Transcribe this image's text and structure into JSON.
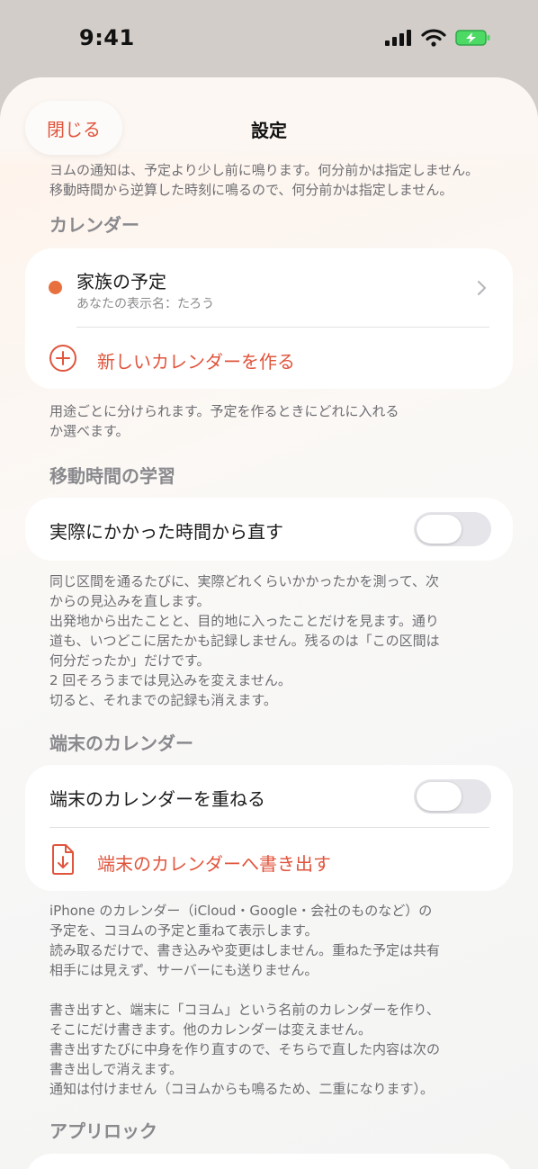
{
  "status": {
    "time": "9:41"
  },
  "nav": {
    "close_label": "閉じる",
    "title": "設定"
  },
  "top_note": {
    "partial_line": "ヨムの通知は、予定より少し前に鳴ります。何分前かは指定しません。",
    "line": "移動時間から逆算した時刻に鳴るので、何分前かは指定しません。"
  },
  "calendar": {
    "header": "カレンダー",
    "item_title": "家族の予定",
    "item_subtitle": "あなたの表示名：たろう",
    "new_label": "新しいカレンダーを作る",
    "dot_color": "#e8703f",
    "note": [
      "用途ごとに分けられます。予定を作るときにどれに入れる",
      "か選べます。"
    ]
  },
  "travel": {
    "header": "移動時間の学習",
    "toggle_label": "実際にかかった時間から直す",
    "toggle_on": false,
    "note": [
      "同じ区間を通るたびに、実際どれくらいかかったかを測って、次",
      "からの見込みを直します。",
      "出発地から出たことと、目的地に入ったことだけを見ます。通り",
      "道も、いつどこに居たかも記録しません。残るのは「この区間は",
      "何分だったか」だけです。",
      "2 回そろうまでは見込みを変えません。",
      "切ると、それまでの記録も消えます。"
    ]
  },
  "device": {
    "header": "端末のカレンダー",
    "overlay_label": "端末のカレンダーを重ねる",
    "overlay_on": false,
    "export_label": "端末のカレンダーへ書き出す",
    "note_a": [
      "iPhone のカレンダー（iCloud・Google・会社のものなど）の",
      "予定を、コヨムの予定と重ねて表示します。",
      "読み取るだけで、書き込みや変更はしません。重ねた予定は共有",
      "相手には見えず、サーバーにも送りません。"
    ],
    "note_b": [
      "書き出すと、端末に「コヨム」という名前のカレンダーを作り、",
      "そこにだけ書きます。他のカレンダーは変えません。",
      "書き出すたびに中身を作り直すので、そちらで直した内容は次の",
      "書き出しで消えます。",
      "通知は付けません（コヨムからも鳴るため、二重になります）。"
    ]
  },
  "applock": {
    "header": "アプリロック"
  },
  "colors": {
    "accent": "#e0553d",
    "section_header": "#8a8a8e"
  }
}
